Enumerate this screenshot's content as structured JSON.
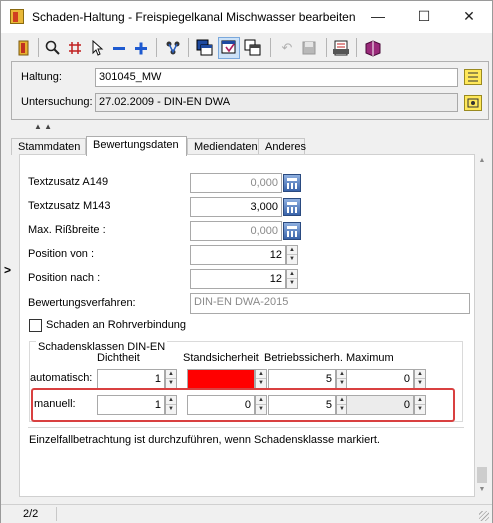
{
  "window": {
    "title": "Schaden-Haltung - Freispiegelkanal Mischwasser bearbeiten",
    "minimize": "—",
    "maximize": "☐",
    "close": "✕"
  },
  "header": {
    "haltung_label": "Haltung:",
    "haltung_value": "301045_MW",
    "untersuchung_label": "Untersuchung:",
    "untersuchung_value": "27.02.2009 - DIN-EN DWA"
  },
  "tabs": [
    "Stammdaten",
    "Bewertungsdaten",
    "Mediendaten",
    "Anderes"
  ],
  "form": {
    "textzusatz_a149_label": "Textzusatz A149",
    "textzusatz_a149_value": "0,000",
    "textzusatz_m143_label": "Textzusatz M143",
    "textzusatz_m143_value": "3,000",
    "max_rissbreite_label": "Max. Rißbreite :",
    "max_rissbreite_value": "0,000",
    "position_von_label": "Position von :",
    "position_von_value": "12",
    "position_nach_label": "Position nach :",
    "position_nach_value": "12",
    "bewertungsverfahren_label": "Bewertungsverfahren:",
    "bewertungsverfahren_value": "DIN-EN DWA-2015",
    "rohrverbindung_label": "Schaden an Rohrverbindung"
  },
  "schadensklassen": {
    "title": "Schadensklassen DIN-EN",
    "columns": [
      "Dichtheit",
      "Standsicherheit",
      "Betriebssicherh.",
      "Maximum"
    ],
    "rows": [
      {
        "label": "automatisch:",
        "values": [
          "1",
          "",
          "5",
          "0"
        ]
      },
      {
        "label": "manuell:",
        "values": [
          "1",
          "0",
          "5",
          "0"
        ]
      }
    ],
    "highlight_color": "#ff0000"
  },
  "note": "Einzelfallbetrachtung ist durchzuführen, wenn Schadensklasse markiert.",
  "status": {
    "page": "2/2"
  },
  "side_arrow": ">"
}
